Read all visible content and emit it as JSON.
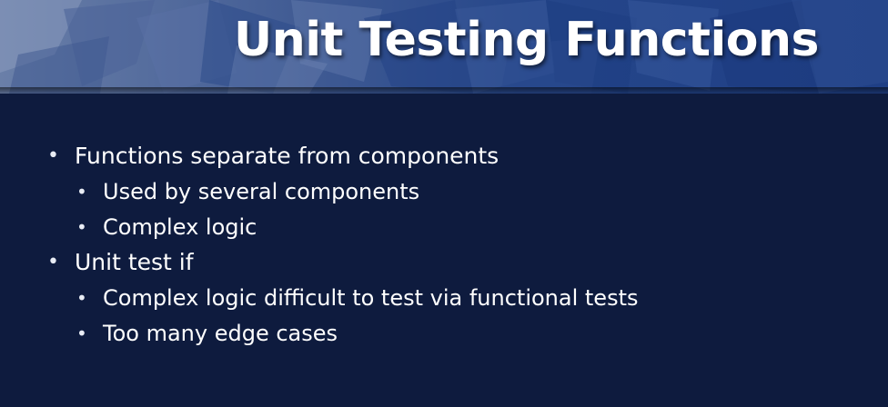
{
  "slide": {
    "title": "Unit Testing Functions",
    "bullets": [
      {
        "text": "Functions separate from components",
        "level": 1
      },
      {
        "text": "Used by several components",
        "level": 2
      },
      {
        "text": "Complex logic",
        "level": 2
      },
      {
        "text": "Unit test if",
        "level": 1
      },
      {
        "text": "Complex logic difficult to test via functional tests",
        "level": 2
      },
      {
        "text": "Too many edge cases",
        "level": 2
      }
    ],
    "bullet_glyph": "•"
  },
  "colors": {
    "background": "#0e1b3e",
    "title_text": "#ffffff",
    "body_text": "#ffffff",
    "banner_accent": "#25468a"
  }
}
